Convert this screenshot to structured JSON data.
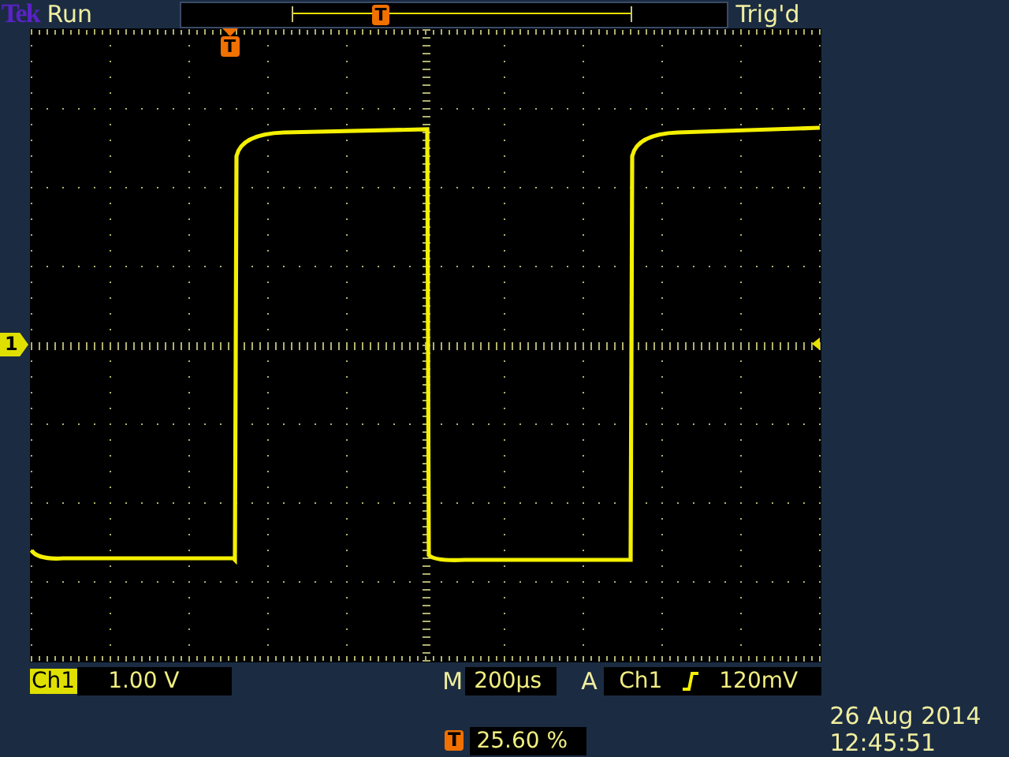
{
  "header": {
    "brand": "Tek",
    "run_state": "Run",
    "record_marker": "T",
    "trigger_status": "Trig'd"
  },
  "screen": {
    "trigger_marker": "T",
    "channel_marker": "1"
  },
  "channel": {
    "label": "Ch1",
    "scale": "1.00 V"
  },
  "timebase": {
    "prefix": "M",
    "value": "200µs"
  },
  "trigger": {
    "prefix": "A",
    "source": "Ch1",
    "level": "120mV"
  },
  "trigger_position": {
    "marker": "T",
    "value": "25.60 %"
  },
  "clock": {
    "date": "26 Aug 2014",
    "time": "12:45:51"
  }
}
